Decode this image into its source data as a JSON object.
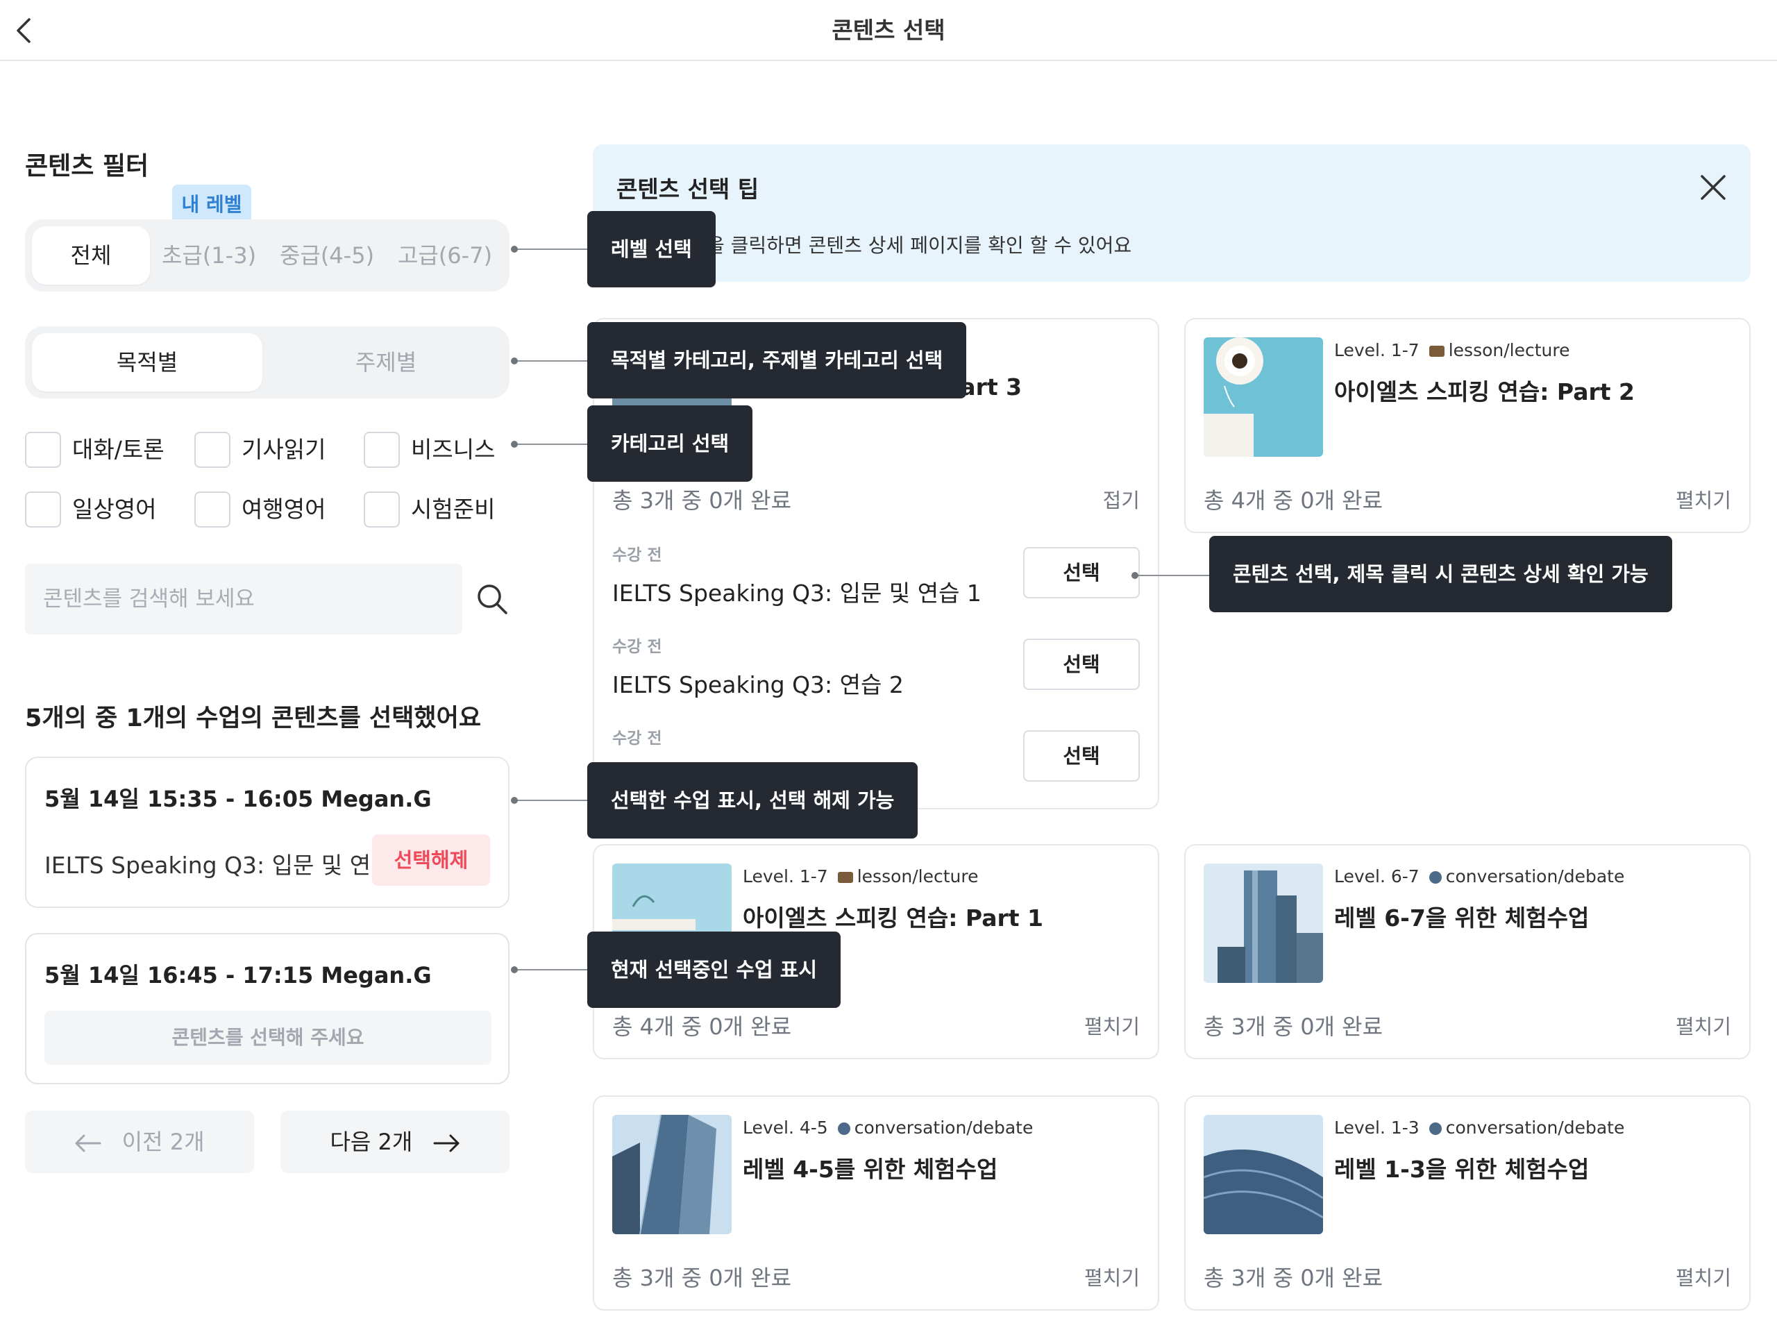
{
  "header": {
    "title": "콘텐츠 선택"
  },
  "filter": {
    "title": "콘텐츠 필터",
    "my_level_badge": "내 레벨",
    "levels": [
      "전체",
      "초급(1-3)",
      "중급(4-5)",
      "고급(6-7)"
    ],
    "category_modes": [
      "목적별",
      "주제별"
    ],
    "categories": [
      "대화/토론",
      "기사읽기",
      "비즈니스",
      "일상영어",
      "여행영어",
      "시험준비"
    ],
    "search_placeholder": "콘텐츠를 검색해 보세요"
  },
  "selection": {
    "summary": "5개의 중 1개의 수업의 콘텐츠를 선택했어요",
    "classes": [
      {
        "title": "5월 14일 15:35 - 16:05 Megan.G",
        "content": "IELTS Speaking Q3: 입문 및 연...",
        "action": "선택해제"
      },
      {
        "title": "5월 14일 16:45 - 17:15 Megan.G",
        "action": "콘텐츠를 선택해 주세요"
      }
    ],
    "prev": "이전 2개",
    "next": "다음 2개"
  },
  "tip": {
    "title": "콘텐츠 선택 팁",
    "text": "을 클릭하면 콘텐츠 상세 페이지를 확인 할 수 있어요"
  },
  "cards": [
    {
      "level": "",
      "category": "e",
      "title": "Part 3",
      "progress": "총 3개 중 0개 완료",
      "toggle": "접기",
      "lessons": [
        {
          "state": "수강 전",
          "title": "IELTS Speaking Q3: 입문 및 연습 1",
          "action": "선택"
        },
        {
          "state": "수강 전",
          "title": "IELTS Speaking Q3: 연습 2",
          "action": "선택"
        },
        {
          "state": "수강 전",
          "title": "",
          "action": "선택"
        }
      ]
    },
    {
      "level": "Level. 1-7",
      "category": "lesson/lecture",
      "title": "아이엘츠 스피킹 연습: Part 2",
      "progress": "총 4개 중 0개 완료",
      "toggle": "펼치기"
    },
    {
      "level": "Level. 1-7",
      "category": "lesson/lecture",
      "title": "아이엘츠 스피킹 연습: Part 1",
      "progress": "총 4개 중 0개 완료",
      "toggle": "펼치기"
    },
    {
      "level": "Level. 6-7",
      "category": "conversation/debate",
      "title": "레벨 6-7을 위한 체험수업",
      "progress": "총 3개 중 0개 완료",
      "toggle": "펼치기"
    },
    {
      "level": "Level. 4-5",
      "category": "conversation/debate",
      "title": "레벨 4-5를 위한 체험수업",
      "progress": "총 3개 중 0개 완료",
      "toggle": "펼치기"
    },
    {
      "level": "Level. 1-3",
      "category": "conversation/debate",
      "title": "레벨 1-3을 위한 체험수업",
      "progress": "총 3개 중 0개 완료",
      "toggle": "펼치기"
    }
  ],
  "annotations": [
    "레벨 선택",
    "목적별 카테고리, 주제별 카테고리 선택",
    "카테고리 선택",
    "콘텐츠 선택, 제목 클릭 시 콘텐츠 상세 확인 가능",
    "선택한 수업 표시, 선택 해제 가능",
    "현재 선택중인 수업 표시"
  ],
  "colors": {
    "tip_background": "#e8f4fc",
    "badge_background": "#cfe8fb",
    "badge_text": "#2f7fd3",
    "unselect_background": "#fde8ea",
    "unselect_text": "#ee4b5a",
    "annotation_background": "#252932"
  }
}
